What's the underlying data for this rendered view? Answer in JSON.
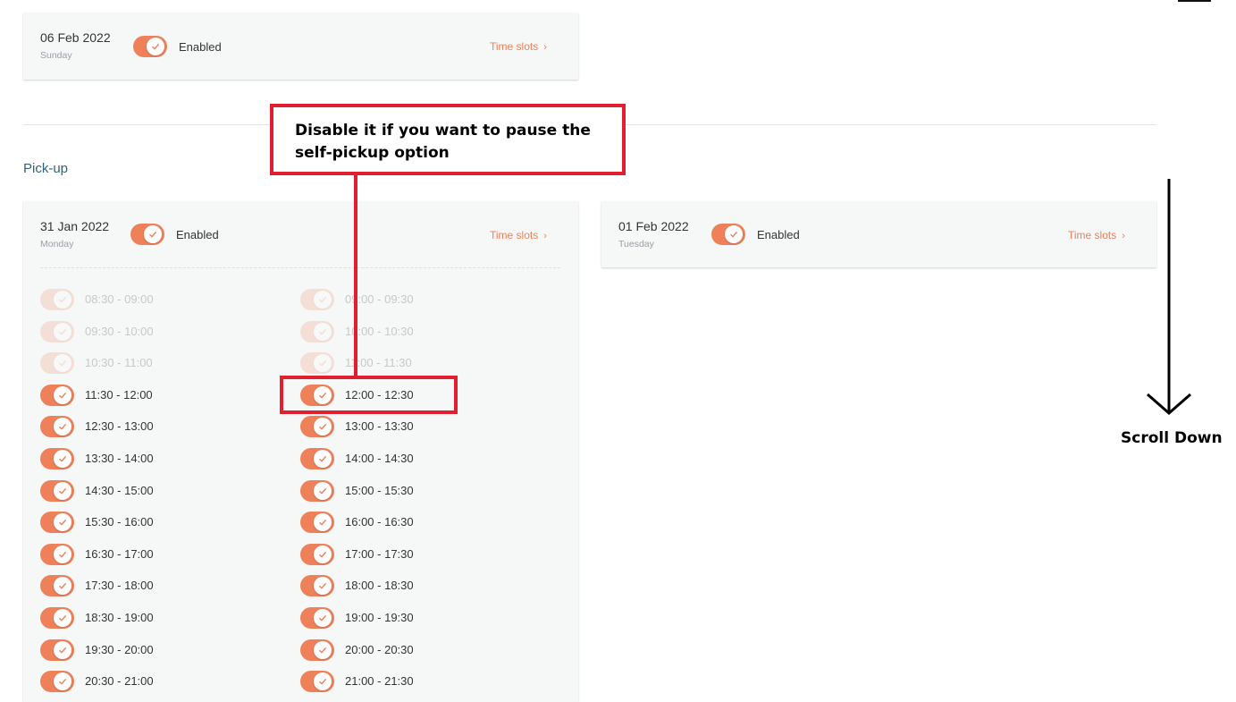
{
  "cards": {
    "top": {
      "date": "06 Feb 2022",
      "weekday": "Sunday",
      "status": "Enabled",
      "time_slots": "Time slots",
      "chevron": "›"
    },
    "left": {
      "date": "31 Jan 2022",
      "weekday": "Monday",
      "status": "Enabled",
      "time_slots": "Time slots",
      "chevron": "›"
    },
    "right": {
      "date": "01 Feb 2022",
      "weekday": "Tuesday",
      "status": "Enabled",
      "time_slots": "Time slots",
      "chevron": "›"
    }
  },
  "section_title": "Pick-up",
  "slots_col1": [
    {
      "label": "08:30 - 09:00",
      "enabled": false
    },
    {
      "label": "09:30 - 10:00",
      "enabled": false
    },
    {
      "label": "10:30 - 11:00",
      "enabled": false
    },
    {
      "label": "11:30 - 12:00",
      "enabled": true
    },
    {
      "label": "12:30 - 13:00",
      "enabled": true
    },
    {
      "label": "13:30 - 14:00",
      "enabled": true
    },
    {
      "label": "14:30 - 15:00",
      "enabled": true
    },
    {
      "label": "15:30 - 16:00",
      "enabled": true
    },
    {
      "label": "16:30 - 17:00",
      "enabled": true
    },
    {
      "label": "17:30 - 18:00",
      "enabled": true
    },
    {
      "label": "18:30 - 19:00",
      "enabled": true
    },
    {
      "label": "19:30 - 20:00",
      "enabled": true
    },
    {
      "label": "20:30 - 21:00",
      "enabled": true
    }
  ],
  "slots_col2": [
    {
      "label": "09:00 - 09:30",
      "enabled": false
    },
    {
      "label": "10:00 - 10:30",
      "enabled": false
    },
    {
      "label": "11:00 - 11:30",
      "enabled": false
    },
    {
      "label": "12:00 - 12:30",
      "enabled": true
    },
    {
      "label": "13:00 - 13:30",
      "enabled": true
    },
    {
      "label": "14:00 - 14:30",
      "enabled": true
    },
    {
      "label": "15:00 - 15:30",
      "enabled": true
    },
    {
      "label": "16:00 - 16:30",
      "enabled": true
    },
    {
      "label": "17:00 - 17:30",
      "enabled": true
    },
    {
      "label": "18:00 - 18:30",
      "enabled": true
    },
    {
      "label": "19:00 - 19:30",
      "enabled": true
    },
    {
      "label": "20:00 - 20:30",
      "enabled": true
    },
    {
      "label": "21:00 - 21:30",
      "enabled": true
    }
  ],
  "annotation": {
    "callout_text": "Disable it if you want to pause the self-pickup option",
    "scroll_text": "Scroll Down"
  },
  "colors": {
    "accent": "#ee8159",
    "annotation_red": "#e0202f",
    "section": "#2f6276"
  }
}
